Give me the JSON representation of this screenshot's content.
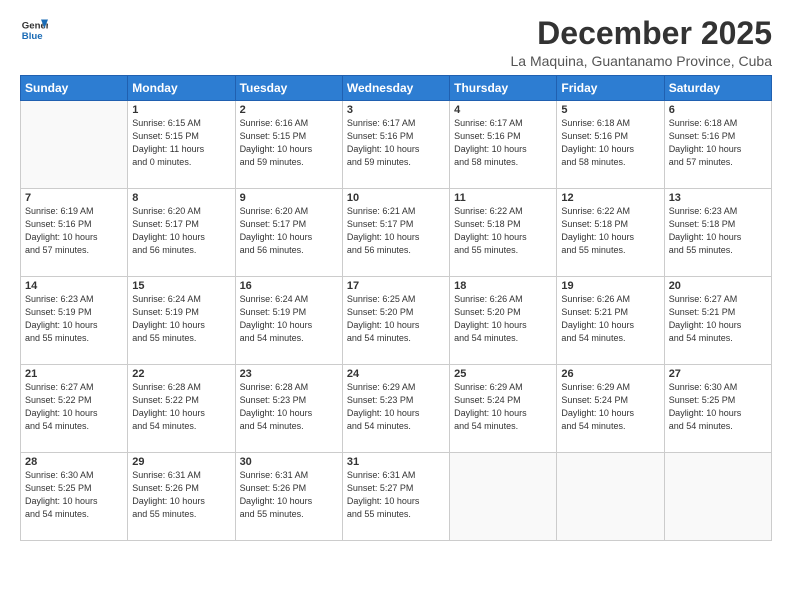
{
  "header": {
    "logo_line1": "General",
    "logo_line2": "Blue",
    "month": "December 2025",
    "location": "La Maquina, Guantanamo Province, Cuba"
  },
  "weekdays": [
    "Sunday",
    "Monday",
    "Tuesday",
    "Wednesday",
    "Thursday",
    "Friday",
    "Saturday"
  ],
  "weeks": [
    [
      {
        "day": "",
        "info": ""
      },
      {
        "day": "1",
        "info": "Sunrise: 6:15 AM\nSunset: 5:15 PM\nDaylight: 11 hours\nand 0 minutes."
      },
      {
        "day": "2",
        "info": "Sunrise: 6:16 AM\nSunset: 5:15 PM\nDaylight: 10 hours\nand 59 minutes."
      },
      {
        "day": "3",
        "info": "Sunrise: 6:17 AM\nSunset: 5:16 PM\nDaylight: 10 hours\nand 59 minutes."
      },
      {
        "day": "4",
        "info": "Sunrise: 6:17 AM\nSunset: 5:16 PM\nDaylight: 10 hours\nand 58 minutes."
      },
      {
        "day": "5",
        "info": "Sunrise: 6:18 AM\nSunset: 5:16 PM\nDaylight: 10 hours\nand 58 minutes."
      },
      {
        "day": "6",
        "info": "Sunrise: 6:18 AM\nSunset: 5:16 PM\nDaylight: 10 hours\nand 57 minutes."
      }
    ],
    [
      {
        "day": "7",
        "info": "Sunrise: 6:19 AM\nSunset: 5:16 PM\nDaylight: 10 hours\nand 57 minutes."
      },
      {
        "day": "8",
        "info": "Sunrise: 6:20 AM\nSunset: 5:17 PM\nDaylight: 10 hours\nand 56 minutes."
      },
      {
        "day": "9",
        "info": "Sunrise: 6:20 AM\nSunset: 5:17 PM\nDaylight: 10 hours\nand 56 minutes."
      },
      {
        "day": "10",
        "info": "Sunrise: 6:21 AM\nSunset: 5:17 PM\nDaylight: 10 hours\nand 56 minutes."
      },
      {
        "day": "11",
        "info": "Sunrise: 6:22 AM\nSunset: 5:18 PM\nDaylight: 10 hours\nand 55 minutes."
      },
      {
        "day": "12",
        "info": "Sunrise: 6:22 AM\nSunset: 5:18 PM\nDaylight: 10 hours\nand 55 minutes."
      },
      {
        "day": "13",
        "info": "Sunrise: 6:23 AM\nSunset: 5:18 PM\nDaylight: 10 hours\nand 55 minutes."
      }
    ],
    [
      {
        "day": "14",
        "info": "Sunrise: 6:23 AM\nSunset: 5:19 PM\nDaylight: 10 hours\nand 55 minutes."
      },
      {
        "day": "15",
        "info": "Sunrise: 6:24 AM\nSunset: 5:19 PM\nDaylight: 10 hours\nand 55 minutes."
      },
      {
        "day": "16",
        "info": "Sunrise: 6:24 AM\nSunset: 5:19 PM\nDaylight: 10 hours\nand 54 minutes."
      },
      {
        "day": "17",
        "info": "Sunrise: 6:25 AM\nSunset: 5:20 PM\nDaylight: 10 hours\nand 54 minutes."
      },
      {
        "day": "18",
        "info": "Sunrise: 6:26 AM\nSunset: 5:20 PM\nDaylight: 10 hours\nand 54 minutes."
      },
      {
        "day": "19",
        "info": "Sunrise: 6:26 AM\nSunset: 5:21 PM\nDaylight: 10 hours\nand 54 minutes."
      },
      {
        "day": "20",
        "info": "Sunrise: 6:27 AM\nSunset: 5:21 PM\nDaylight: 10 hours\nand 54 minutes."
      }
    ],
    [
      {
        "day": "21",
        "info": "Sunrise: 6:27 AM\nSunset: 5:22 PM\nDaylight: 10 hours\nand 54 minutes."
      },
      {
        "day": "22",
        "info": "Sunrise: 6:28 AM\nSunset: 5:22 PM\nDaylight: 10 hours\nand 54 minutes."
      },
      {
        "day": "23",
        "info": "Sunrise: 6:28 AM\nSunset: 5:23 PM\nDaylight: 10 hours\nand 54 minutes."
      },
      {
        "day": "24",
        "info": "Sunrise: 6:29 AM\nSunset: 5:23 PM\nDaylight: 10 hours\nand 54 minutes."
      },
      {
        "day": "25",
        "info": "Sunrise: 6:29 AM\nSunset: 5:24 PM\nDaylight: 10 hours\nand 54 minutes."
      },
      {
        "day": "26",
        "info": "Sunrise: 6:29 AM\nSunset: 5:24 PM\nDaylight: 10 hours\nand 54 minutes."
      },
      {
        "day": "27",
        "info": "Sunrise: 6:30 AM\nSunset: 5:25 PM\nDaylight: 10 hours\nand 54 minutes."
      }
    ],
    [
      {
        "day": "28",
        "info": "Sunrise: 6:30 AM\nSunset: 5:25 PM\nDaylight: 10 hours\nand 54 minutes."
      },
      {
        "day": "29",
        "info": "Sunrise: 6:31 AM\nSunset: 5:26 PM\nDaylight: 10 hours\nand 55 minutes."
      },
      {
        "day": "30",
        "info": "Sunrise: 6:31 AM\nSunset: 5:26 PM\nDaylight: 10 hours\nand 55 minutes."
      },
      {
        "day": "31",
        "info": "Sunrise: 6:31 AM\nSunset: 5:27 PM\nDaylight: 10 hours\nand 55 minutes."
      },
      {
        "day": "",
        "info": ""
      },
      {
        "day": "",
        "info": ""
      },
      {
        "day": "",
        "info": ""
      }
    ]
  ]
}
